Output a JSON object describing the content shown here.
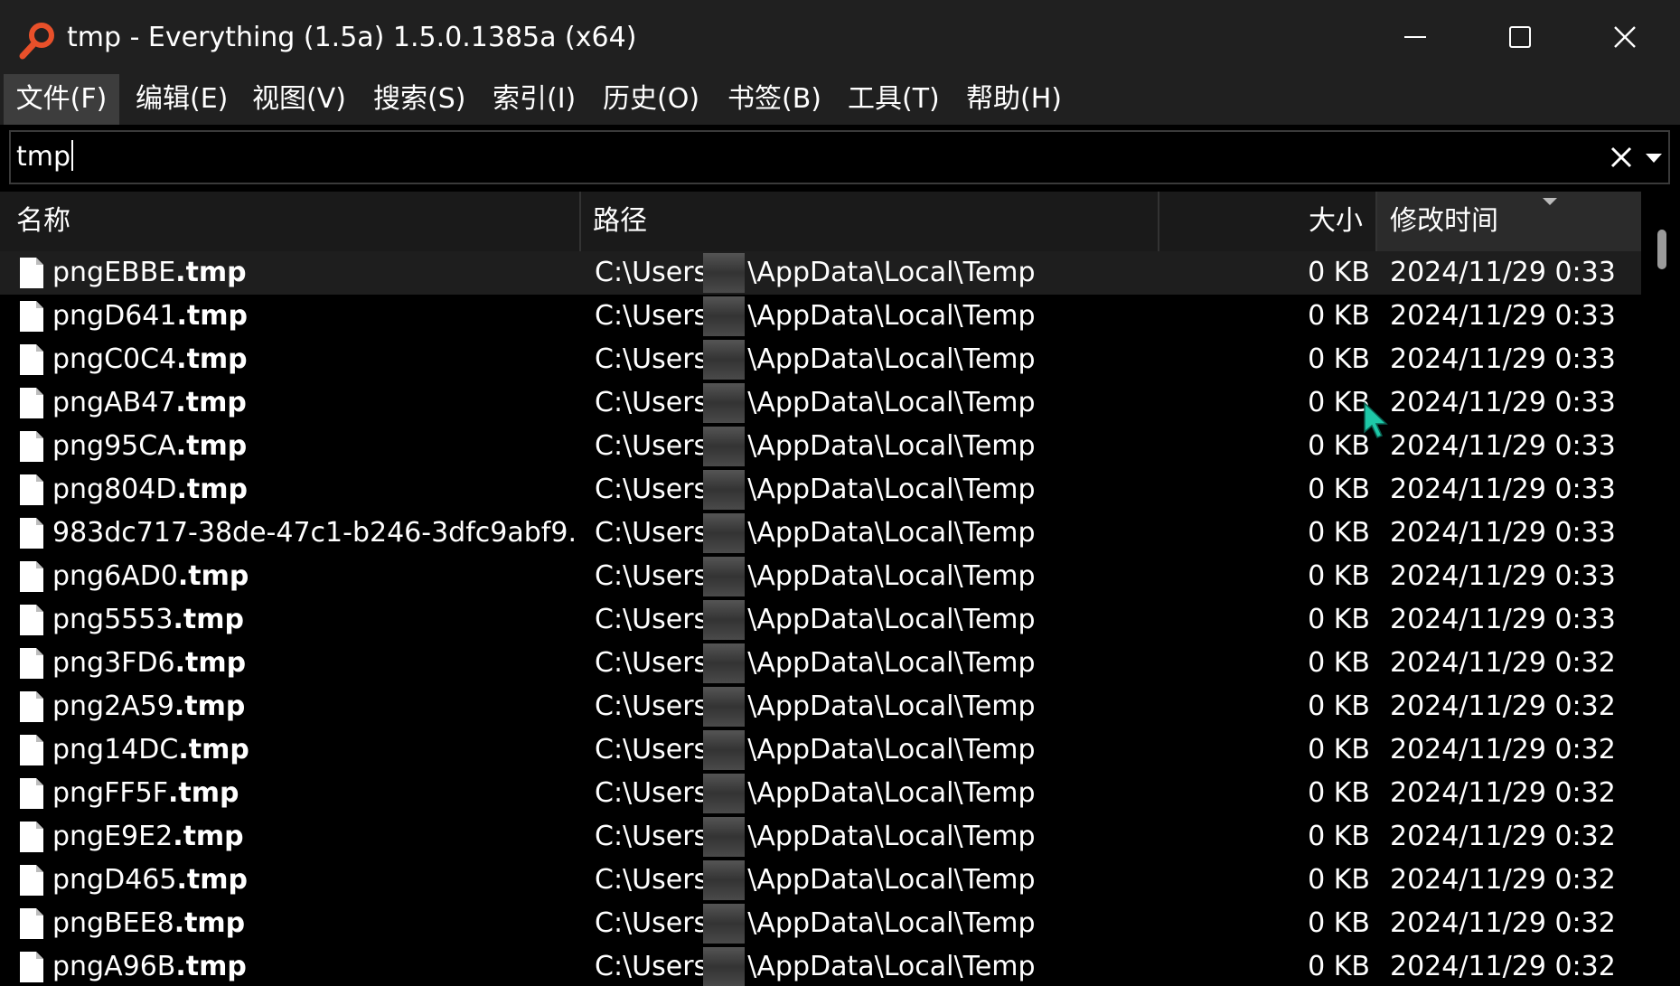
{
  "window": {
    "title": "tmp - Everything (1.5a) 1.5.0.1385a (x64)",
    "app_icon": "magnifier-icon",
    "controls": [
      "minimize-icon",
      "maximize-icon",
      "close-icon"
    ]
  },
  "menu": {
    "items": [
      "文件(F)",
      "编辑(E)",
      "视图(V)",
      "搜索(S)",
      "索引(I)",
      "历史(O)",
      "书签(B)",
      "工具(T)",
      "帮助(H)"
    ],
    "active_index": 0
  },
  "search": {
    "value": "tmp",
    "clear_icon": "clear-icon",
    "dropdown_icon": "chevron-down-icon"
  },
  "columns": {
    "name": "名称",
    "path": "路径",
    "size": "大小",
    "modified": "修改时间",
    "sorted_by": "修改时间"
  },
  "rows": [
    {
      "name_prefix": "pngEBBE",
      "name_ext": ".tmp",
      "path_start": "C:\\Users\\",
      "path_end": "\\AppData\\Local\\Temp",
      "size": "0 KB",
      "modified": "2024/11/29 0:33"
    },
    {
      "name_prefix": "pngD641",
      "name_ext": ".tmp",
      "path_start": "C:\\Users\\",
      "path_end": "\\AppData\\Local\\Temp",
      "size": "0 KB",
      "modified": "2024/11/29 0:33"
    },
    {
      "name_prefix": "pngC0C4",
      "name_ext": ".tmp",
      "path_start": "C:\\Users\\",
      "path_end": "\\AppData\\Local\\Temp",
      "size": "0 KB",
      "modified": "2024/11/29 0:33"
    },
    {
      "name_prefix": "pngAB47",
      "name_ext": ".tmp",
      "path_start": "C:\\Users\\",
      "path_end": "\\AppData\\Local\\Temp",
      "size": "0 KB",
      "modified": "2024/11/29 0:33"
    },
    {
      "name_prefix": "png95CA",
      "name_ext": ".tmp",
      "path_start": "C:\\Users\\",
      "path_end": "\\AppData\\Local\\Temp",
      "size": "0 KB",
      "modified": "2024/11/29 0:33"
    },
    {
      "name_prefix": "png804D",
      "name_ext": ".tmp",
      "path_start": "C:\\Users\\",
      "path_end": "\\AppData\\Local\\Temp",
      "size": "0 KB",
      "modified": "2024/11/29 0:33"
    },
    {
      "name_prefix": "983dc717-38de-47c1-b246-3dfc9abf9...",
      "name_ext": "",
      "path_start": "C:\\Users\\",
      "path_end": "\\AppData\\Local\\Temp",
      "size": "0 KB",
      "modified": "2024/11/29 0:33"
    },
    {
      "name_prefix": "png6AD0",
      "name_ext": ".tmp",
      "path_start": "C:\\Users\\",
      "path_end": "\\AppData\\Local\\Temp",
      "size": "0 KB",
      "modified": "2024/11/29 0:33"
    },
    {
      "name_prefix": "png5553",
      "name_ext": ".tmp",
      "path_start": "C:\\Users\\",
      "path_end": "\\AppData\\Local\\Temp",
      "size": "0 KB",
      "modified": "2024/11/29 0:33"
    },
    {
      "name_prefix": "png3FD6",
      "name_ext": ".tmp",
      "path_start": "C:\\Users\\",
      "path_end": "\\AppData\\Local\\Temp",
      "size": "0 KB",
      "modified": "2024/11/29 0:32"
    },
    {
      "name_prefix": "png2A59",
      "name_ext": ".tmp",
      "path_start": "C:\\Users\\",
      "path_end": "\\AppData\\Local\\Temp",
      "size": "0 KB",
      "modified": "2024/11/29 0:32"
    },
    {
      "name_prefix": "png14DC",
      "name_ext": ".tmp",
      "path_start": "C:\\Users\\",
      "path_end": "\\AppData\\Local\\Temp",
      "size": "0 KB",
      "modified": "2024/11/29 0:32"
    },
    {
      "name_prefix": "pngFF5F",
      "name_ext": ".tmp",
      "path_start": "C:\\Users\\",
      "path_end": "\\AppData\\Local\\Temp",
      "size": "0 KB",
      "modified": "2024/11/29 0:32"
    },
    {
      "name_prefix": "pngE9E2",
      "name_ext": ".tmp",
      "path_start": "C:\\Users\\",
      "path_end": "\\AppData\\Local\\Temp",
      "size": "0 KB",
      "modified": "2024/11/29 0:32"
    },
    {
      "name_prefix": "pngD465",
      "name_ext": ".tmp",
      "path_start": "C:\\Users\\",
      "path_end": "\\AppData\\Local\\Temp",
      "size": "0 KB",
      "modified": "2024/11/29 0:32"
    },
    {
      "name_prefix": "pngBEE8",
      "name_ext": ".tmp",
      "path_start": "C:\\Users\\",
      "path_end": "\\AppData\\Local\\Temp",
      "size": "0 KB",
      "modified": "2024/11/29 0:32"
    },
    {
      "name_prefix": "pngA96B",
      "name_ext": ".tmp",
      "path_start": "C:\\Users\\",
      "path_end": "\\AppData\\Local\\Temp",
      "size": "0 KB",
      "modified": "2024/11/29 0:32"
    }
  ],
  "selected_row": 0,
  "colors": {
    "background": "#000000",
    "chrome": "#202020",
    "app_icon": "#e8502a",
    "cursor": "#1ec9a8"
  }
}
